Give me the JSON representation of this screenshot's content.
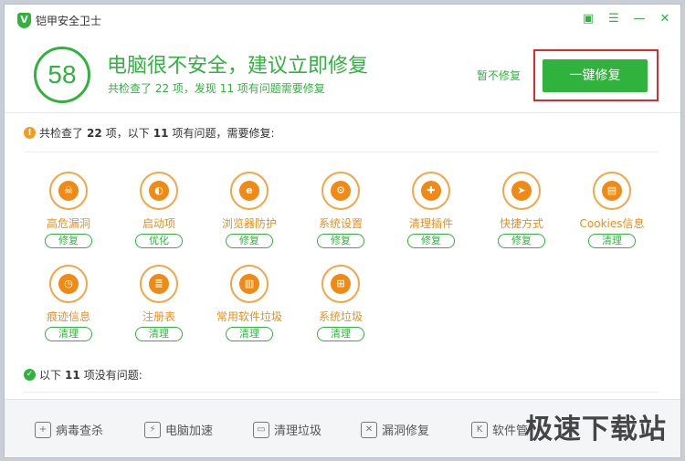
{
  "window": {
    "title": "铠甲安全卫士",
    "logo_glyph": "V",
    "controls": [
      {
        "name": "feedback-icon",
        "glyph": "▣"
      },
      {
        "name": "menu-icon",
        "glyph": "☰"
      },
      {
        "name": "minimize-icon",
        "glyph": "—"
      },
      {
        "name": "close-icon",
        "glyph": "✕"
      }
    ]
  },
  "header": {
    "score": "58",
    "title": "电脑很不安全，建议立即修复",
    "subtitle": "共检查了 22 项，发现 11 项有问题需要修复",
    "skip_label": "暂不修复",
    "fix_all_label": "一键修复"
  },
  "problems": {
    "heading_prefix": "共检查了",
    "checked_count": "22",
    "heading_mid1": "项，以下",
    "problem_count": "11",
    "heading_mid2": "项有问题，需要修复:",
    "items": [
      {
        "label": "高危漏洞",
        "action": "修复",
        "glyph": "☠",
        "icon": "skull-icon"
      },
      {
        "label": "启动项",
        "action": "优化",
        "glyph": "◐",
        "icon": "toggle-icon"
      },
      {
        "label": "浏览器防护",
        "action": "修复",
        "glyph": "e",
        "icon": "browser-icon"
      },
      {
        "label": "系统设置",
        "action": "修复",
        "glyph": "⚙",
        "icon": "gear-icon"
      },
      {
        "label": "清理插件",
        "action": "修复",
        "glyph": "✚",
        "icon": "puzzle-icon"
      },
      {
        "label": "快捷方式",
        "action": "修复",
        "glyph": "➤",
        "icon": "shortcut-icon"
      },
      {
        "label": "Cookies信息",
        "action": "清理",
        "glyph": "▤",
        "icon": "cookie-doc-icon"
      },
      {
        "label": "痕迹信息",
        "action": "清理",
        "glyph": "◷",
        "icon": "clock-icon"
      },
      {
        "label": "注册表",
        "action": "清理",
        "glyph": "≣",
        "icon": "registry-icon"
      },
      {
        "label": "常用软件垃圾",
        "action": "清理",
        "glyph": "▥",
        "icon": "trash-icon"
      },
      {
        "label": "系统垃圾",
        "action": "清理",
        "glyph": "⊞",
        "icon": "windows-icon"
      }
    ]
  },
  "no_problems": {
    "heading_prefix": "以下",
    "count": "11",
    "heading_suffix": "项没有问题:"
  },
  "toolbar": {
    "items": [
      {
        "label": "病毒查杀",
        "glyph": "+",
        "icon": "shield-icon"
      },
      {
        "label": "电脑加速",
        "glyph": "⚡",
        "icon": "speedup-icon"
      },
      {
        "label": "清理垃圾",
        "glyph": "▭",
        "icon": "broom-icon"
      },
      {
        "label": "漏洞修复",
        "glyph": "✕",
        "icon": "tools-icon"
      },
      {
        "label": "软件管",
        "glyph": "K",
        "icon": "software-icon"
      }
    ]
  },
  "watermark": "极速下载站",
  "colors": {
    "accent": "#2fb33c",
    "warning": "#f08a14",
    "highlight_border": "#e02a2a"
  }
}
